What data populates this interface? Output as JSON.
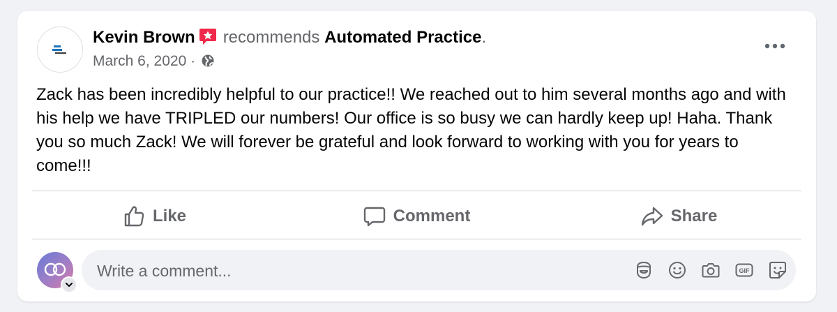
{
  "post": {
    "author": "Kevin Brown",
    "action_text": "recommends",
    "page_name": "Automated Practice",
    "period": ".",
    "date": "March 6, 2020",
    "separator": " · ",
    "body": "Zack has been incredibly helpful to our practice!! We reached out to him several months ago and with his help we have TRIPLED our numbers! Our office is so busy we can hardly keep up! Haha. Thank you so much Zack! We will forever be grateful and look forward to working with you for years to come!!!"
  },
  "actions": {
    "like_label": "Like",
    "comment_label": "Comment",
    "share_label": "Share"
  },
  "comment_box": {
    "placeholder": "Write a comment...",
    "gif_label": "GIF"
  },
  "icons": {
    "badge": "recommendation-star-icon",
    "audience": "globe-icon",
    "more": "more-options-icon"
  },
  "colors": {
    "badge": "#f02849",
    "secondary_text": "#65676b",
    "background": "#f0f2f5"
  }
}
